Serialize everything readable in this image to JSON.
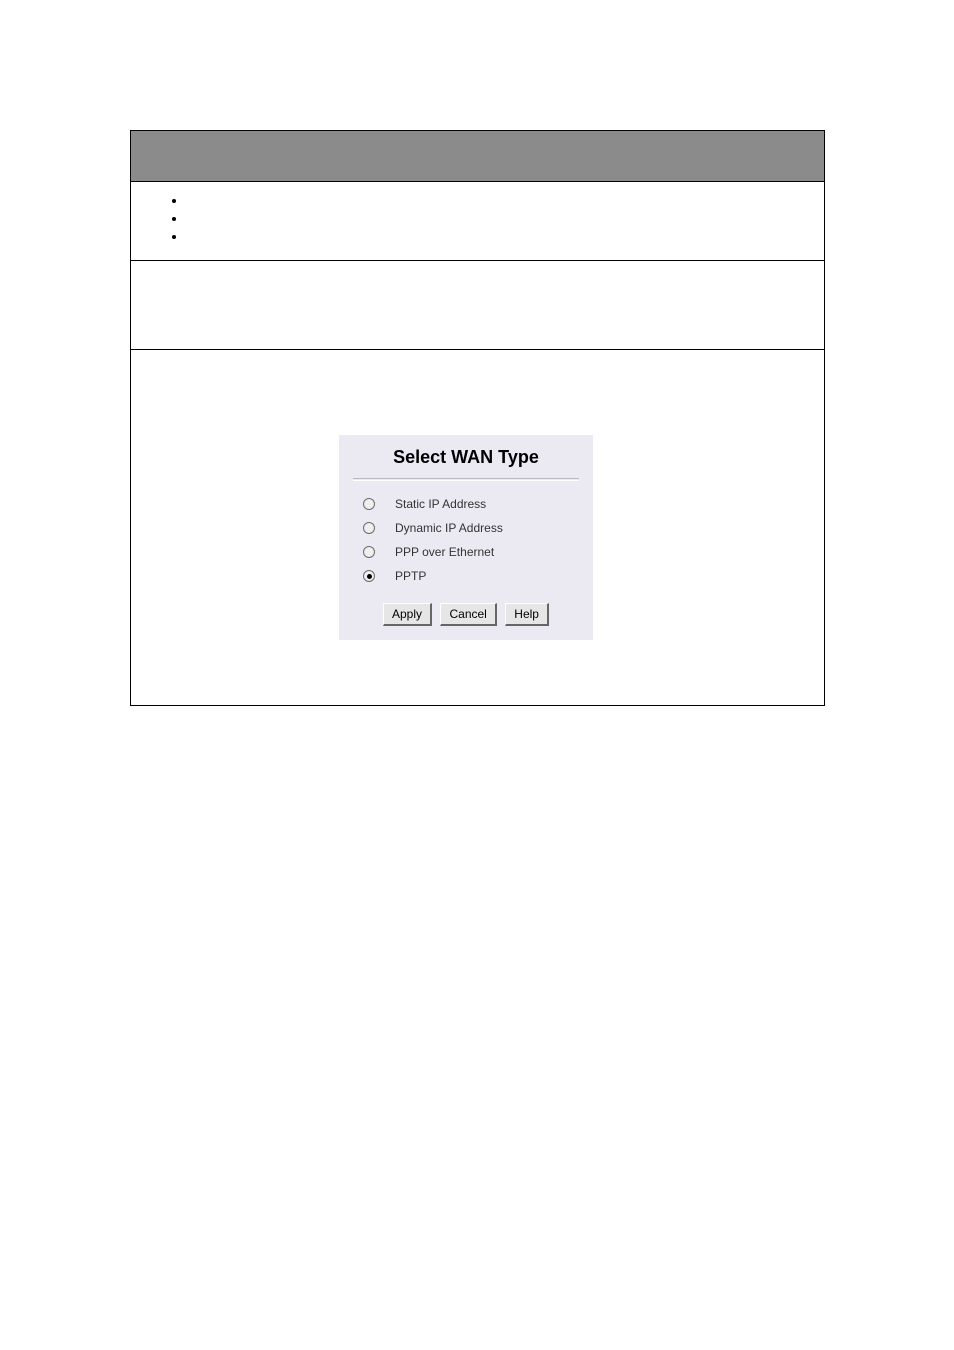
{
  "dialog": {
    "title": "Select WAN Type",
    "options": [
      {
        "label": "Static IP Address",
        "checked": false
      },
      {
        "label": "Dynamic IP Address",
        "checked": false
      },
      {
        "label": "PPP over Ethernet",
        "checked": false
      },
      {
        "label": "PPTP",
        "checked": true
      }
    ],
    "buttons": {
      "apply": "Apply",
      "cancel": "Cancel",
      "help": "Help"
    }
  }
}
